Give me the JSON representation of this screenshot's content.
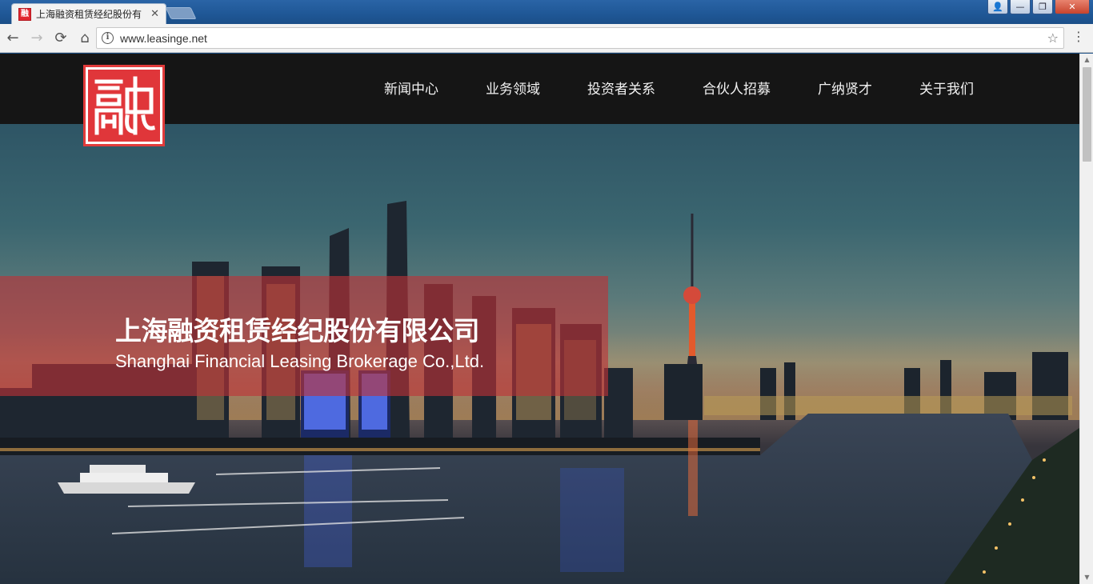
{
  "browser": {
    "tab_title": "上海融资租赁经纪股份有",
    "tab_favicon_char": "融",
    "tab_close": "✕",
    "url": "www.leasinge.net",
    "window_buttons": {
      "user": "👤",
      "minimize": "—",
      "maximize": "❐",
      "close": "✕"
    },
    "nav": {
      "back": "←",
      "forward": "→",
      "reload": "⟳",
      "home": "⌂",
      "info": "i",
      "star": "☆",
      "menu": "⋮"
    }
  },
  "site": {
    "nav_items": [
      "新闻中心",
      "业务领域",
      "投资者关系",
      "合伙人招募",
      "广纳贤才",
      "关于我们"
    ],
    "hero": {
      "title_cn": "上海融资租赁经纪股份有限公司",
      "title_en": "Shanghai Financial Leasing Brokerage Co.,Ltd."
    },
    "colors": {
      "header_bg": "#151515",
      "logo_red": "#e0363a",
      "banner_red": "#be3237"
    }
  },
  "scrollbar": {
    "up": "▲",
    "down": "▼"
  }
}
